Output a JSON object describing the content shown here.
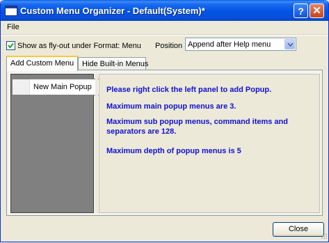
{
  "window": {
    "title": "Custom Menu Organizer - Default(System)*"
  },
  "titlebar": {
    "help_label": "?",
    "close_label": "✕"
  },
  "menubar": {
    "file": "File"
  },
  "options": {
    "flyout_label": "Show as fly-out under Format: Menu",
    "flyout_checked": true,
    "position_label": "Position",
    "position_value": "Append after Help menu"
  },
  "tabs": [
    {
      "label": "Add Custom Menu",
      "active": true
    },
    {
      "label": "Hide Built-in Menus",
      "active": false
    }
  ],
  "left_panel": {
    "context_item": "New Main Popup"
  },
  "messages": [
    "Please right click the left panel to add Popup.",
    "Maximum main popup menus are 3.",
    "Maximum sub popup menus, command items and separators are 128.",
    "Maximum depth of popup menus is 5"
  ],
  "footer": {
    "close_label": "Close"
  },
  "colors": {
    "message_text": "#1010d0",
    "titlebar": "#0054e3"
  }
}
